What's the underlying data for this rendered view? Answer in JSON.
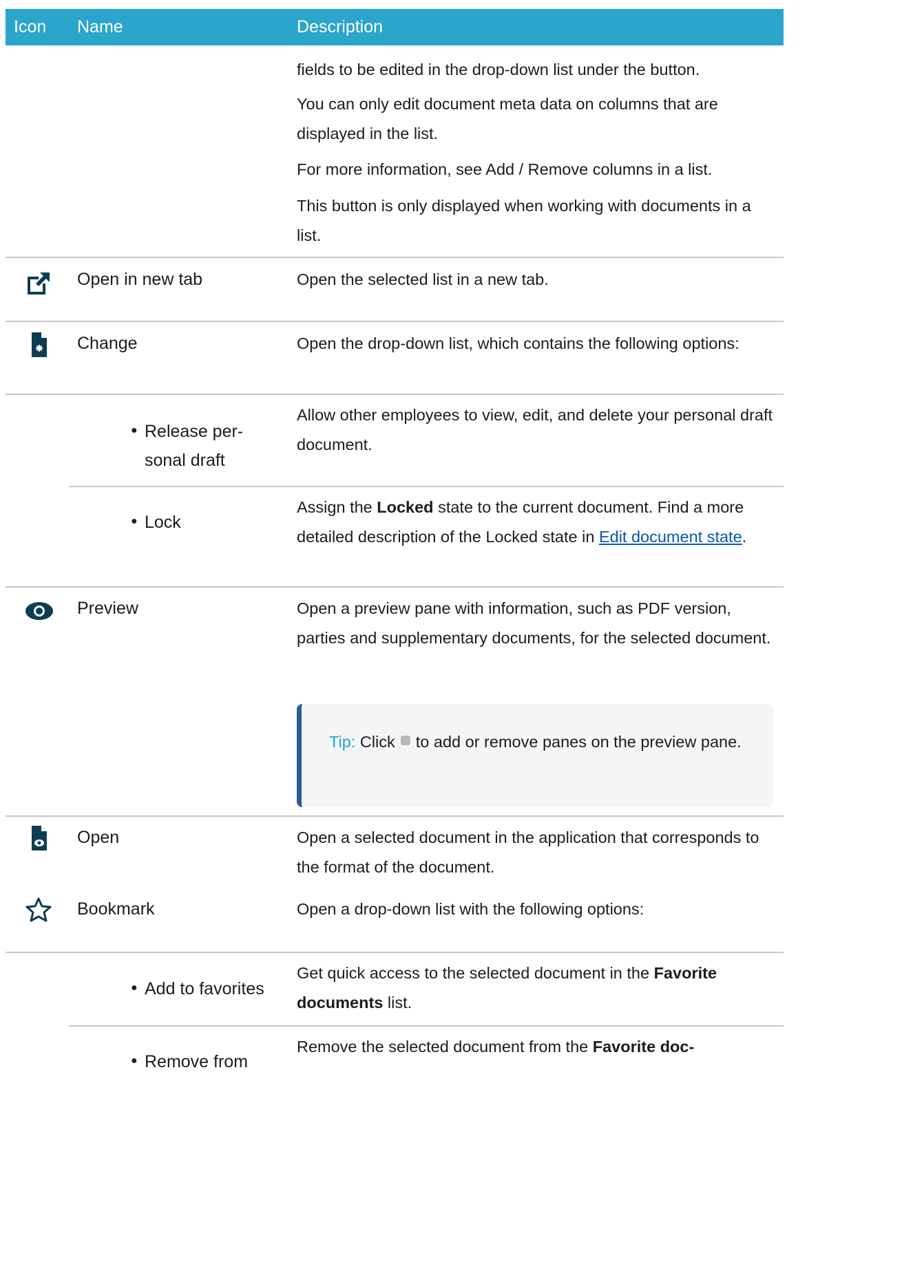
{
  "header": {
    "icon_col": "Icon",
    "name_col": "Name",
    "desc_col": "Description"
  },
  "top_block": {
    "line1": "fields to be edited in the drop-down list under the button.",
    "para2": "You can only edit document meta data on columns that are displayed in the list.",
    "para3": "For more information, see Add / Remove columns in a list.",
    "para4": "This button is only displayed when working with documents in a list."
  },
  "rows": {
    "open_new_tab": {
      "icon": "external-link-icon",
      "name": "Open in new tab",
      "desc": "Open the selected list in a new tab."
    },
    "change": {
      "icon": "document-change-icon",
      "name": "Change",
      "desc": "Open the drop-down list, which contains the following options:"
    },
    "release": {
      "name_line1": "Release per-",
      "name_line2": "sonal draft",
      "desc": "Allow other employees to view, edit, and delete your personal draft document."
    },
    "lock": {
      "name": "Lock",
      "desc_prefix": "Assign the ",
      "desc_bold": "Locked",
      "desc_middle": " state to the current document. Find a more detailed description of the Locked state in ",
      "desc_link": "Edit document state",
      "desc_suffix": "."
    },
    "preview": {
      "icon": "eye-icon",
      "name": "Preview",
      "desc": "Open a preview pane with information, such as PDF version, parties and supplementary documents, for the selected document.",
      "tip_label": "Tip:",
      "tip_before": "Click",
      "tip_icon": "settings-icon",
      "tip_after": "to add or remove panes on the preview pane."
    },
    "open": {
      "icon": "document-eye-icon",
      "name": "Open",
      "desc": "Open a selected document in the application that corresponds to the format of the document."
    },
    "bookmark": {
      "icon": "star-icon",
      "name": "Bookmark",
      "desc": "Open a drop-down list with the following options:"
    },
    "add_fav": {
      "name": "Add to favorites",
      "desc_prefix": "Get quick access to the selected document in the ",
      "desc_bold": "Favorite documents",
      "desc_suffix": " list."
    },
    "remove_fav": {
      "name": "Remove from",
      "desc_prefix": "Remove the selected document from the ",
      "desc_bold": "Favorite doc-"
    }
  }
}
